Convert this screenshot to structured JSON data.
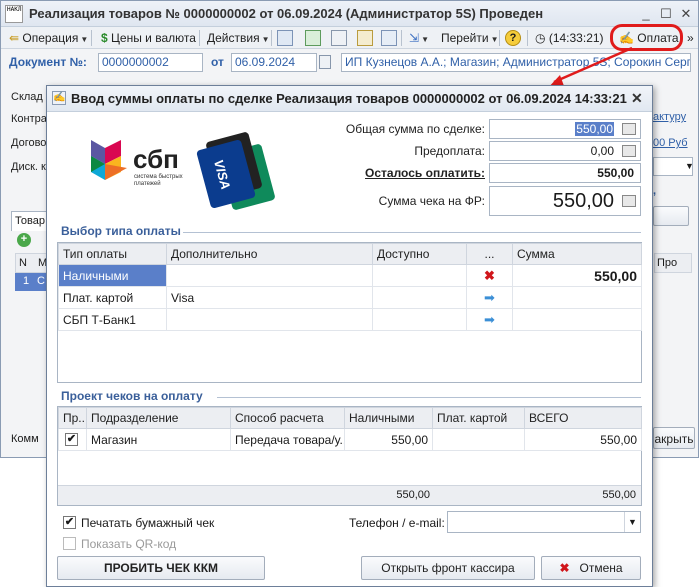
{
  "window": {
    "title": "Реализация товаров № 0000000002 от 06.09.2024 (Администратор 5S) Проведен",
    "logo_text": "НАКЛ"
  },
  "toolbar": {
    "operation": "Операция",
    "prices": "Цены и валюта",
    "actions": "Действия",
    "goto": "Перейти",
    "time": "(14:33:21)",
    "pay": "Оплата",
    "more": "»"
  },
  "document": {
    "label": "Документ №:",
    "number": "0000000002",
    "from_label": "от",
    "date": "06.09.2024",
    "org": "ИП Кузнецов А.А.; Магазин; Администратор 5S; Сорокин Сергей"
  },
  "background_form": {
    "labels": [
      "Склад н",
      "Контра",
      "Догово",
      "Диск. к"
    ],
    "link_text": "актуру",
    "link_sum": "00 Руб",
    "tab_label": "Товар",
    "col_n": "N",
    "col_m": "М",
    "row_n": "1",
    "row_c": "С",
    "col_pro": "Про",
    "comment_label": "Комм",
    "close_label": "акрыть"
  },
  "dialog": {
    "title": "Ввод суммы оплаты по сделке Реализация товаров 0000000002 от 06.09.2024 14:33:21",
    "totals": {
      "total_label": "Общая сумма по сделке:",
      "total_value": "550,00",
      "prepay_label": "Предоплата:",
      "prepay_value": "0,00",
      "remain_label": "Осталось оплатить:",
      "remain_value": "550,00",
      "fr_label": "Сумма чека на ФР:",
      "fr_value": "550,00"
    },
    "logos": {
      "sbp_title": "сбп",
      "sbp_sub": "система быстрых платежей",
      "visa": "VISA"
    },
    "payment_section": {
      "title": "Выбор типа оплаты",
      "columns": [
        "Тип оплаты",
        "Дополнительно",
        "Доступно",
        "...",
        "Сумма"
      ],
      "rows": [
        {
          "type": "Наличными",
          "extra": "",
          "available": "",
          "action": "remove",
          "sum": "550,00"
        },
        {
          "type": "Плат. картой",
          "extra": "Visa",
          "available": "",
          "action": "add",
          "sum": ""
        },
        {
          "type": "СБП Т-Банк1",
          "extra": "",
          "available": "",
          "action": "add",
          "sum": ""
        }
      ]
    },
    "checks_section": {
      "title": "Проект чеков на оплату",
      "columns": [
        "Пр...",
        "Подразделение",
        "Способ расчета",
        "Наличными",
        "Плат. картой",
        "ВСЕГО"
      ],
      "rows": [
        {
          "checked": true,
          "division": "Магазин",
          "method": "Передача товара/у...",
          "cash": "550,00",
          "card": "",
          "total": "550,00"
        }
      ],
      "footer": {
        "cash": "550,00",
        "card": "",
        "total": "550,00"
      }
    },
    "options": {
      "print_paper": "Печатать бумажный чек",
      "show_qr": "Показать QR-код",
      "phone_label": "Телефон / e-mail:",
      "phone_value": ""
    },
    "buttons": {
      "print_kkm": "ПРОБИТЬ ЧЕК ККМ",
      "open_front": "Открыть фронт кассира",
      "cancel": "Отмена"
    }
  },
  "colors": {
    "accent_blue": "#3060a8",
    "selection": "#5a7fc9",
    "annotation_red": "#e01b1b"
  }
}
